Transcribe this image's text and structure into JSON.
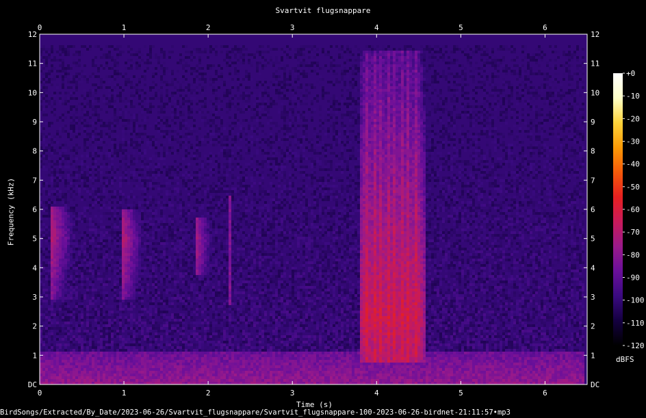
{
  "chart_data": {
    "type": "heatmap",
    "title": "Svartvit flugsnappare",
    "xlabel": "Time (s)",
    "ylabel": "Frequency (kHz)",
    "xlim": [
      0,
      6.5
    ],
    "ylim": [
      0,
      12
    ],
    "x_ticks": [
      "0",
      "1",
      "2",
      "3",
      "4",
      "5",
      "6"
    ],
    "y_ticks": [
      "DC",
      "1",
      "2",
      "3",
      "4",
      "5",
      "6",
      "7",
      "8",
      "9",
      "10",
      "11",
      "12"
    ],
    "colorbar": {
      "label": "dBFS",
      "range": [
        -120,
        0
      ],
      "ticks": [
        "+0",
        "-10",
        "-20",
        "-30",
        "-40",
        "-50",
        "-60",
        "-70",
        "-80",
        "-90",
        "-100",
        "-110",
        "-120"
      ],
      "colors": [
        "#000000",
        "#140040",
        "#3a0a80",
        "#6a0f9a",
        "#9a1a8a",
        "#c81a5a",
        "#e62020",
        "#f55a0a",
        "#fb9a06",
        "#fcd23a",
        "#ffffc8",
        "#ffffff"
      ]
    },
    "background_db": -100,
    "low_freq_band": {
      "freq_khz_max": 1.2,
      "db": -78
    },
    "events": [
      {
        "name": "chirp",
        "t_start": 0.12,
        "t_end": 0.4,
        "f_low_khz": 3.0,
        "f_high_khz": 6.1,
        "peak_khz": 5.1,
        "db": -70
      },
      {
        "name": "chirp",
        "t_start": 0.95,
        "t_end": 1.2,
        "f_low_khz": 3.0,
        "f_high_khz": 6.0,
        "peak_khz": 5.0,
        "db": -68
      },
      {
        "name": "chirp",
        "t_start": 1.85,
        "t_end": 2.05,
        "f_low_khz": 3.8,
        "f_high_khz": 5.8,
        "peak_khz": 4.9,
        "db": -74
      },
      {
        "name": "click",
        "t_start": 2.22,
        "t_end": 2.26,
        "f_low_khz": 2.8,
        "f_high_khz": 6.5,
        "peak_khz": 5.0,
        "db": -82
      },
      {
        "name": "broadband",
        "t_start": 3.78,
        "t_end": 4.55,
        "f_low_khz": 0.8,
        "f_high_khz": 11.5,
        "peak_khz": 2.3,
        "db": -60
      }
    ]
  },
  "footer": {
    "path": "BirdSongs/Extracted/By_Date/2023-06-26/Svartvit_flugsnappare/Svartvit_flugsnappare-100-2023-06-26-birdnet-21:11:57•mp3"
  }
}
